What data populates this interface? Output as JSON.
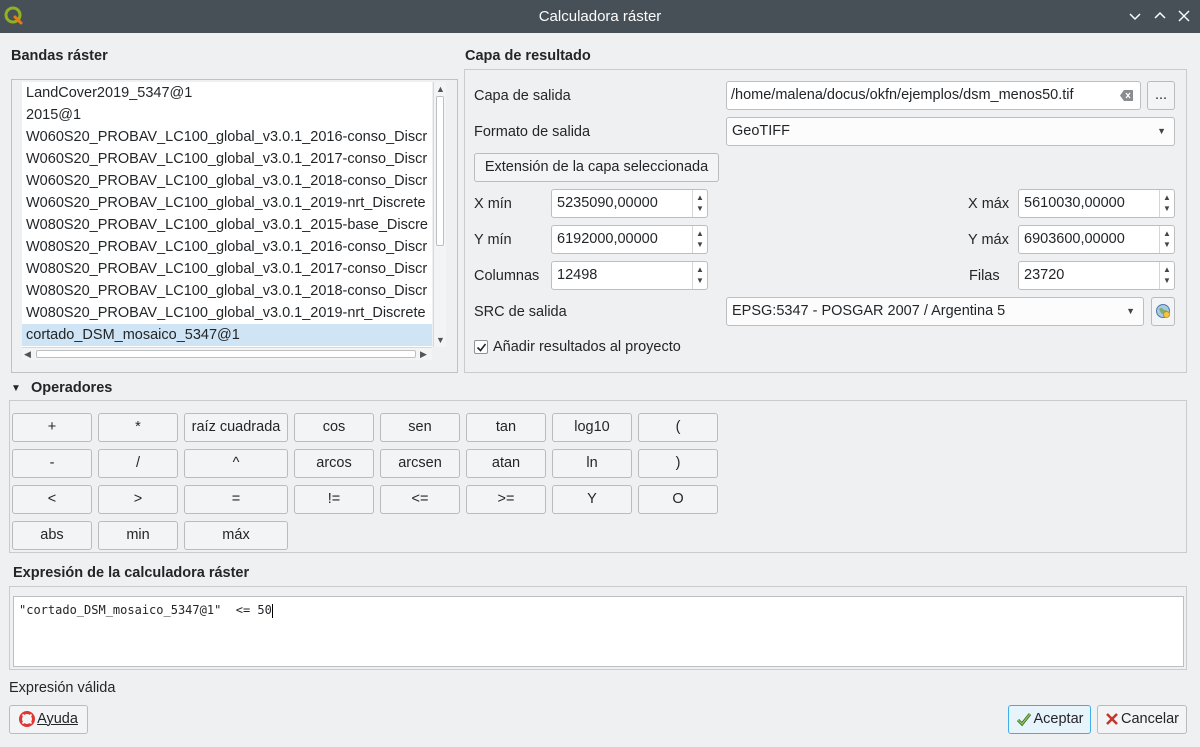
{
  "window": {
    "title": "Calculadora ráster"
  },
  "bands": {
    "section_title": "Bandas ráster",
    "items": [
      "LandCover2019_5347@1",
      "2015@1",
      "W060S20_PROBAV_LC100_global_v3.0.1_2016-conso_Discr",
      "W060S20_PROBAV_LC100_global_v3.0.1_2017-conso_Discr",
      "W060S20_PROBAV_LC100_global_v3.0.1_2018-conso_Discr",
      "W060S20_PROBAV_LC100_global_v3.0.1_2019-nrt_Discrete",
      "W080S20_PROBAV_LC100_global_v3.0.1_2015-base_Discre",
      "W080S20_PROBAV_LC100_global_v3.0.1_2016-conso_Discr",
      "W080S20_PROBAV_LC100_global_v3.0.1_2017-conso_Discr",
      "W080S20_PROBAV_LC100_global_v3.0.1_2018-conso_Discr",
      "W080S20_PROBAV_LC100_global_v3.0.1_2019-nrt_Discrete",
      "cortado_DSM_mosaico_5347@1"
    ],
    "selected_index": 11
  },
  "result": {
    "section_title": "Capa de resultado",
    "output_layer_label": "Capa de salida",
    "output_layer_value": "/home/malena/docus/okfn/ejemplos/dsm_menos50.tif",
    "browse_label": "...",
    "format_label": "Formato de salida",
    "format_value": "GeoTIFF",
    "extent_button": "Extensión de la capa seleccionada",
    "xmin_label": "X mín",
    "xmin_value": "5235090,00000",
    "xmax_label": "X máx",
    "xmax_value": "5610030,00000",
    "ymin_label": "Y mín",
    "ymin_value": "6192000,00000",
    "ymax_label": "Y máx",
    "ymax_value": "6903600,00000",
    "columns_label": "Columnas",
    "columns_value": "12498",
    "rows_label": "Filas",
    "rows_value": "23720",
    "crs_label": "SRC de salida",
    "crs_value": "EPSG:5347 - POSGAR 2007 / Argentina 5",
    "add_to_project_label": "Añadir resultados al proyecto",
    "add_to_project_checked": true
  },
  "operators": {
    "section_title": "Operadores",
    "rows": [
      [
        "+",
        "*",
        "raíz cuadrada",
        "cos",
        "sen",
        "tan",
        "log10",
        "("
      ],
      [
        "-",
        "/",
        "^",
        "arcos",
        "arcsen",
        "atan",
        "ln",
        ")"
      ],
      [
        "<",
        ">",
        "=",
        "!=",
        "<=",
        ">=",
        "Y",
        "O"
      ],
      [
        "abs",
        "min",
        "máx"
      ]
    ]
  },
  "expression": {
    "section_title": "Expresión de la calculadora ráster",
    "value": "\"cortado_DSM_mosaico_5347@1\"  <= 50"
  },
  "status": {
    "text": "Expresión válida"
  },
  "buttons": {
    "help": "Ayuda",
    "ok": "Aceptar",
    "cancel": "Cancelar"
  }
}
